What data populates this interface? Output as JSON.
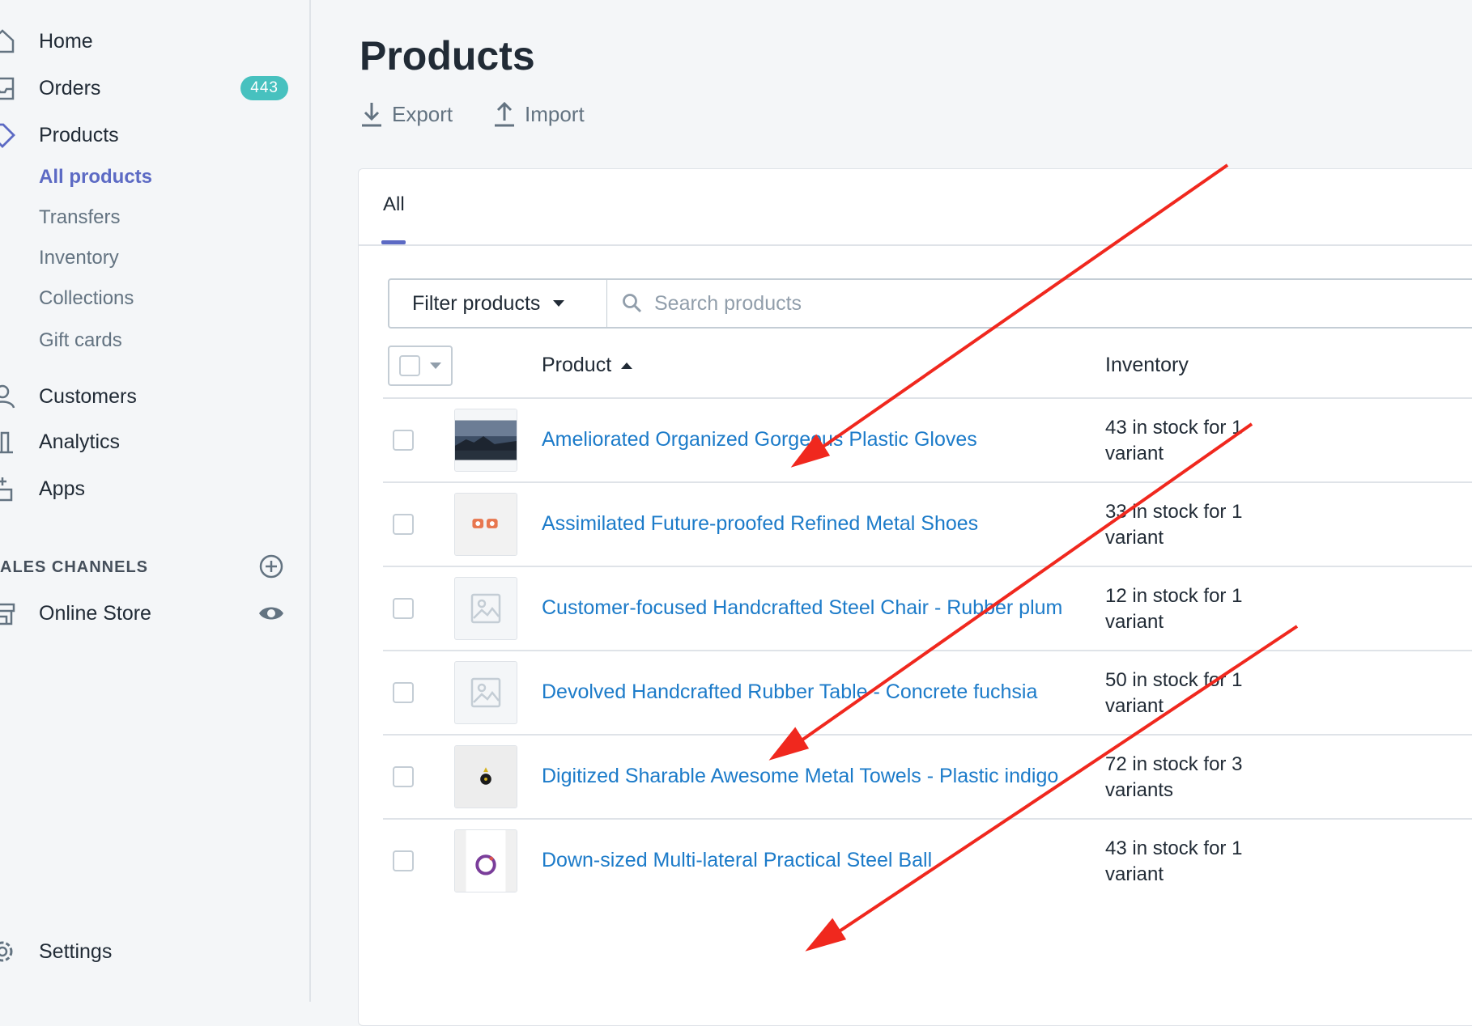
{
  "sidebar": {
    "items": [
      {
        "label": "Home",
        "icon": "home-icon"
      },
      {
        "label": "Orders",
        "icon": "orders-icon",
        "badge": "443"
      },
      {
        "label": "Products",
        "icon": "tag-icon"
      },
      {
        "label": "Customers",
        "icon": "customers-icon"
      },
      {
        "label": "Analytics",
        "icon": "analytics-icon"
      },
      {
        "label": "Apps",
        "icon": "apps-icon"
      }
    ],
    "product_subitems": [
      "All products",
      "Transfers",
      "Inventory",
      "Collections",
      "Gift cards"
    ],
    "active_subitem": "All products",
    "sales_channels_title": "ALES CHANNELS",
    "online_store": "Online Store",
    "settings": "Settings"
  },
  "page": {
    "title": "Products",
    "export_label": "Export",
    "import_label": "Import",
    "tab_all": "All",
    "filter_label": "Filter products",
    "search_placeholder": "Search products",
    "col_product": "Product",
    "col_inventory": "Inventory"
  },
  "products": [
    {
      "name": "Ameliorated Organized Gorgeous Plastic Gloves",
      "inventory_line1": "43 in stock for 1",
      "inventory_line2": "variant",
      "thumb": "landscape"
    },
    {
      "name": "Assimilated Future-proofed Refined Metal Shoes",
      "inventory_line1": "33 in stock for 1",
      "inventory_line2": "variant",
      "thumb": "shoes"
    },
    {
      "name": "Customer-focused Handcrafted Steel Chair - Rubber plum",
      "inventory_line1": "12 in stock for 1",
      "inventory_line2": "variant",
      "thumb": "placeholder"
    },
    {
      "name": "Devolved Handcrafted Rubber Table - Concrete fuchsia",
      "inventory_line1": "50 in stock for 1",
      "inventory_line2": "variant",
      "thumb": "placeholder"
    },
    {
      "name": "Digitized Sharable Awesome Metal Towels - Plastic indigo",
      "inventory_line1": "72 in stock for 3",
      "inventory_line2": "variants",
      "thumb": "bottle"
    },
    {
      "name": "Down-sized Multi-lateral Practical Steel Ball",
      "inventory_line1": "43 in stock for 1",
      "inventory_line2": "variant",
      "thumb": "ring"
    }
  ],
  "colors": {
    "link": "#1c7bc9",
    "accent": "#5c6ac4",
    "badge": "#47c1bf",
    "annotation_arrow": "#f0281e"
  }
}
